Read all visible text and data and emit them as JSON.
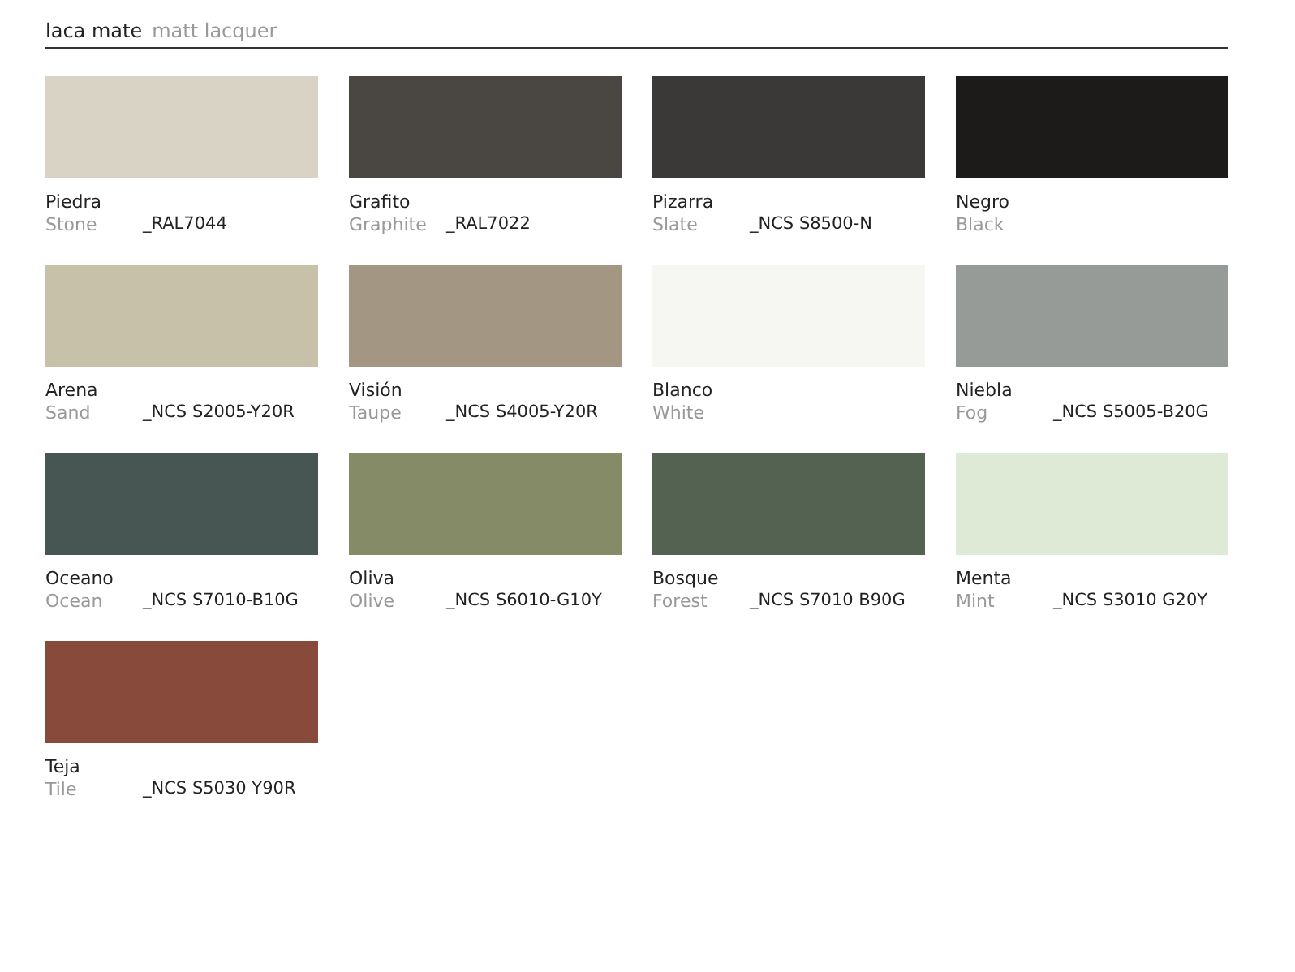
{
  "header": {
    "title": "laca mate",
    "subtitle": "matt lacquer"
  },
  "swatches": [
    {
      "name": "Piedra",
      "english": "Stone",
      "code": "_RAL7044",
      "color": "#d8d3c4"
    },
    {
      "name": "Grafito",
      "english": "Graphite",
      "code": "_RAL7022",
      "color": "#4a4641"
    },
    {
      "name": "Pizarra",
      "english": "Slate",
      "code": "_NCS S8500-N",
      "color": "#3a3937"
    },
    {
      "name": "Negro",
      "english": "Black",
      "color": "#1c1b1a"
    },
    {
      "name": "Arena",
      "english": "Sand",
      "code": "_NCS S2005-Y20R",
      "color": "#c8c1aa"
    },
    {
      "name": "Visión",
      "english": "Taupe",
      "code": "_NCS S4005-Y20R",
      "color": "#a39784"
    },
    {
      "name": "Blanco",
      "english": "White",
      "color": "#f6f6f3"
    },
    {
      "name": "Niebla",
      "english": "Fog",
      "code": "_NCS S5005-B20G",
      "color": "#979b97"
    },
    {
      "name": "Oceano",
      "english": "Ocean",
      "code": "_NCS S7010-B10G",
      "color": "#475653"
    },
    {
      "name": "Oliva",
      "english": "Olive",
      "code": "_NCS S6010-G10Y",
      "color": "#848b66"
    },
    {
      "name": "Bosque",
      "english": "Forest",
      "code": "_NCS S7010 B90G",
      "color": "#546351"
    },
    {
      "name": "Menta",
      "english": "Mint",
      "code": "_NCS S3010 G20Y",
      "color": "#deead6"
    },
    {
      "name": "Teja",
      "english": "Tile",
      "code": "_NCS S5030 Y90R",
      "color": "#884a3b"
    }
  ]
}
